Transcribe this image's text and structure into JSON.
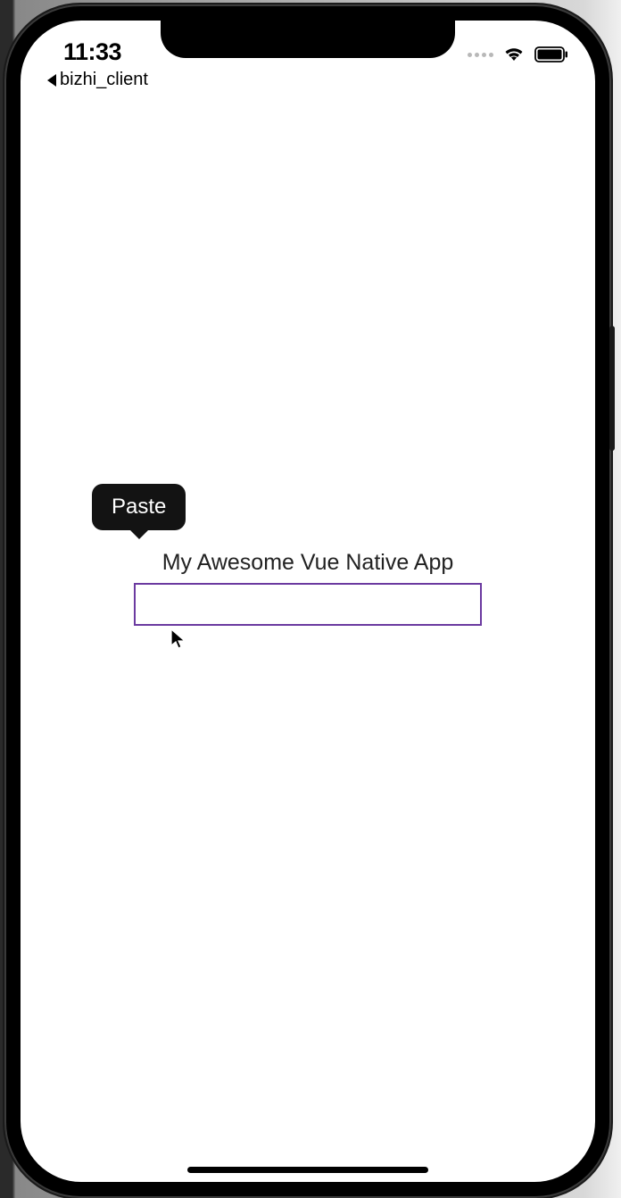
{
  "status_bar": {
    "time": "11:33",
    "back_app_name": "bizhi_client"
  },
  "app": {
    "title": "My Awesome Vue Native App",
    "input_value": ""
  },
  "context_menu": {
    "paste_label": "Paste"
  }
}
